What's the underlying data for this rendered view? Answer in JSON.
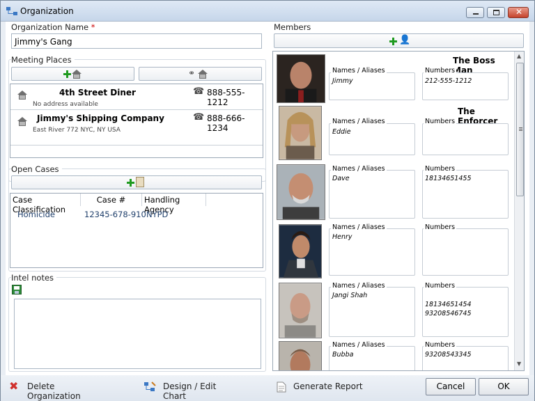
{
  "window": {
    "title": "Organization"
  },
  "org": {
    "name_label": "Organization Name",
    "required_mark": "*",
    "name_value": "Jimmy's Gang"
  },
  "meeting": {
    "label": "Meeting Places",
    "places": [
      {
        "name": "4th Street Diner",
        "address": "No address available",
        "phone": "888-555-1212"
      },
      {
        "name": "Jimmy's Shipping Company",
        "address": "East River 772\nNYC, NY  USA",
        "phone": "888-666-1234"
      }
    ]
  },
  "cases": {
    "label": "Open Cases",
    "columns": [
      "Case Classification",
      "Case #",
      "Handling Agency"
    ],
    "rows": [
      [
        "Homicide",
        "12345-678-910",
        "NYPD"
      ]
    ]
  },
  "intel": {
    "label": "Intel notes",
    "value": ""
  },
  "members": {
    "label": "Members",
    "names_label": "Names / Aliases",
    "numbers_label": "Numbers",
    "list": [
      {
        "title": "The Boss Man",
        "alias": "Jimmy",
        "numbers": "212-555-1212"
      },
      {
        "title": "The Enforcer",
        "alias": "Eddie",
        "numbers": ""
      },
      {
        "title": "",
        "alias": "Dave",
        "numbers": "18134651455"
      },
      {
        "title": "",
        "alias": "Henry",
        "numbers": ""
      },
      {
        "title": "",
        "alias": "Jangi Shah",
        "numbers": "18134651454\n93208546745"
      },
      {
        "title": "",
        "alias": "Bubba",
        "numbers": "93208543345"
      }
    ]
  },
  "footer": {
    "delete": "Delete Organization",
    "design": "Design / Edit Chart",
    "report": "Generate Report",
    "cancel": "Cancel",
    "ok": "OK"
  }
}
